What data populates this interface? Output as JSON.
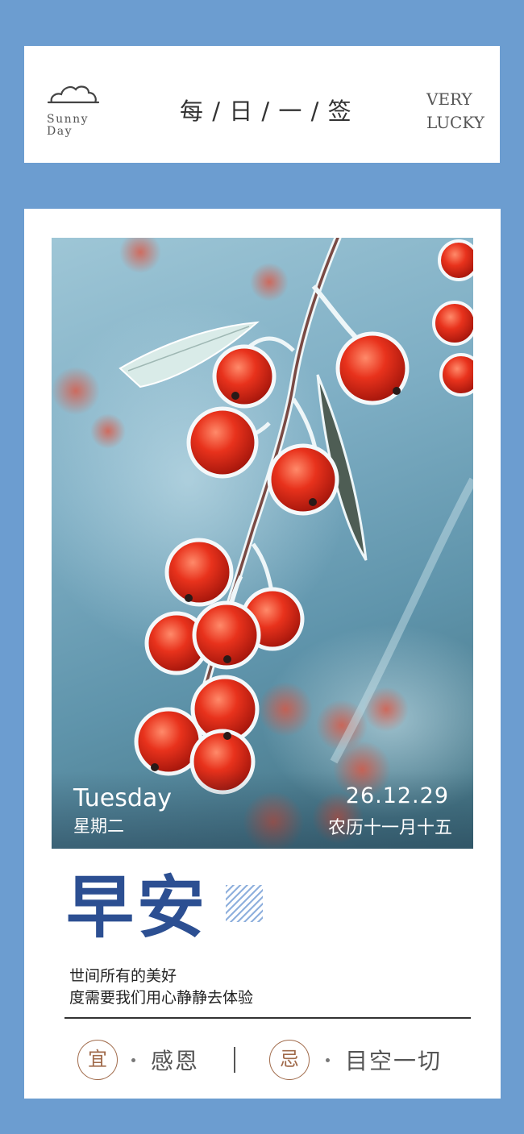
{
  "header": {
    "logo_line1": "Sunny",
    "logo_line2": "Day",
    "title": "每 / 日 / 一 / 签",
    "lucky_line1": "VERY",
    "lucky_line2": "LUCKY"
  },
  "photo": {
    "weekday": "Tuesday",
    "weekday_cn": "星期二",
    "date": "26.12.29",
    "lunar_date": "农历十一月十五"
  },
  "greeting": "早安",
  "quote": {
    "line1": "世间所有的美好",
    "line2": "度需要我们用心静静去体验"
  },
  "advice": {
    "yi_label": "宜",
    "yi_text": "感恩",
    "ji_label": "忌",
    "ji_text": "目空一切"
  },
  "colors": {
    "background": "#6c9dd0",
    "greeting": "#2c4f92",
    "badge": "#a06a4a"
  },
  "icons": [
    "cloud-icon"
  ]
}
